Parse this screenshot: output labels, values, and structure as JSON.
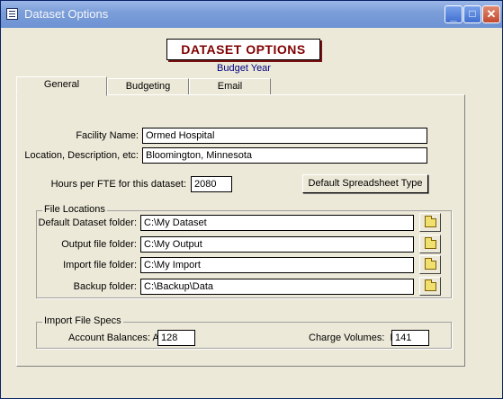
{
  "window": {
    "title": "Dataset Options"
  },
  "header": {
    "title": "DATASET OPTIONS",
    "subtitle": "Budget Year"
  },
  "tabs": [
    {
      "label": "General",
      "active": true
    },
    {
      "label": "Budgeting",
      "active": false
    },
    {
      "label": "Email",
      "active": false
    }
  ],
  "general": {
    "facility_label": "Facility Name:",
    "facility_value": "Ormed Hospital",
    "location_label": "Location, Description, etc:",
    "location_value": "Bloomington, Minnesota",
    "hours_label": "Hours per FTE for this dataset:",
    "hours_value": "2080",
    "default_spreadsheet_button": "Default Spreadsheet Type"
  },
  "file_locations": {
    "group_label": "File Locations",
    "rows": [
      {
        "label": "Default Dataset folder:",
        "value": "C:\\My Dataset"
      },
      {
        "label": "Output file folder:",
        "value": "C:\\My Output"
      },
      {
        "label": "Import file folder:",
        "value": "C:\\My Import"
      },
      {
        "label": "Backup folder:",
        "value": "C:\\Backup\\Data"
      }
    ]
  },
  "import_specs": {
    "group_label": "Import File Specs",
    "account_label": "Account Balances: A",
    "account_value": "128",
    "charge_label": "Charge Volumes:  P",
    "charge_value": "141"
  },
  "icons": {
    "folder": "folder-icon",
    "window": "form-icon"
  }
}
